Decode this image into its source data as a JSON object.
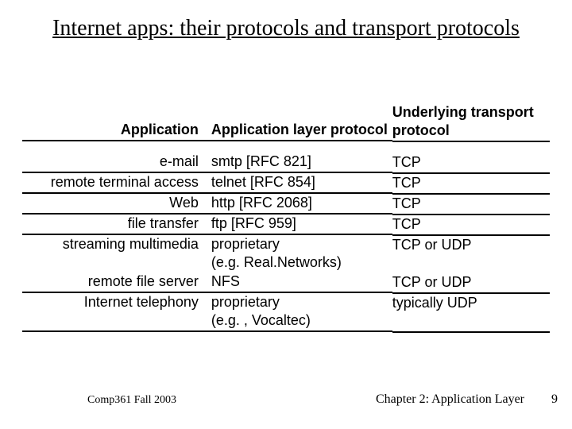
{
  "title": "Internet apps: their protocols and transport protocols",
  "headers": {
    "app": "Application",
    "proto": "Application\nlayer protocol",
    "trans": "Underlying\ntransport protocol"
  },
  "rows": [
    {
      "app": "e-mail",
      "proto": "smtp [RFC 821]",
      "trans": "TCP"
    },
    {
      "app": "remote terminal access",
      "proto": "telnet [RFC 854]",
      "trans": "TCP"
    },
    {
      "app": "Web",
      "proto": "http [RFC 2068]",
      "trans": "TCP"
    },
    {
      "app": "file transfer",
      "proto": "ftp [RFC 959]",
      "trans": "TCP"
    },
    {
      "app": "streaming multimedia",
      "proto": "proprietary\n(e.g. Real.Networks)",
      "trans": "TCP or UDP"
    },
    {
      "app": "remote file server",
      "proto": "NFS",
      "trans": "TCP or UDP"
    },
    {
      "app": "Internet telephony",
      "proto": "proprietary\n(e.g. , Vocaltec)",
      "trans": "typically UDP"
    }
  ],
  "footer": {
    "left": "Comp361   Fall 2003",
    "right": "Chapter 2: Application Layer",
    "page": "9"
  }
}
